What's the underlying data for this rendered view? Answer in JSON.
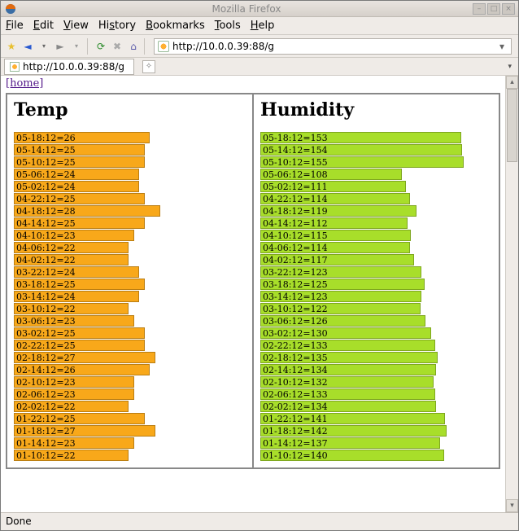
{
  "window": {
    "title": "Mozilla Firefox"
  },
  "menu": {
    "file": "File",
    "edit": "Edit",
    "view": "View",
    "history": "History",
    "bookmarks": "Bookmarks",
    "tools": "Tools",
    "help": "Help"
  },
  "url": "http://10.0.0.39:88/g",
  "tab_label": "http://10.0.0.39:88/g",
  "home_link": "[home]",
  "status": "Done",
  "chart_data": [
    {
      "type": "bar",
      "title": "Temp",
      "orientation": "horizontal",
      "color": "#f8a81a",
      "max": 28,
      "series": [
        {
          "label": "05-18:12",
          "value": 26
        },
        {
          "label": "05-14:12",
          "value": 25
        },
        {
          "label": "05-10:12",
          "value": 25
        },
        {
          "label": "05-06:12",
          "value": 24
        },
        {
          "label": "05-02:12",
          "value": 24
        },
        {
          "label": "04-22:12",
          "value": 25
        },
        {
          "label": "04-18:12",
          "value": 28
        },
        {
          "label": "04-14:12",
          "value": 25
        },
        {
          "label": "04-10:12",
          "value": 23
        },
        {
          "label": "04-06:12",
          "value": 22
        },
        {
          "label": "04-02:12",
          "value": 22
        },
        {
          "label": "03-22:12",
          "value": 24
        },
        {
          "label": "03-18:12",
          "value": 25
        },
        {
          "label": "03-14:12",
          "value": 24
        },
        {
          "label": "03-10:12",
          "value": 22
        },
        {
          "label": "03-06:12",
          "value": 23
        },
        {
          "label": "03-02:12",
          "value": 25
        },
        {
          "label": "02-22:12",
          "value": 25
        },
        {
          "label": "02-18:12",
          "value": 27
        },
        {
          "label": "02-14:12",
          "value": 26
        },
        {
          "label": "02-10:12",
          "value": 23
        },
        {
          "label": "02-06:12",
          "value": 23
        },
        {
          "label": "02-02:12",
          "value": 22
        },
        {
          "label": "01-22:12",
          "value": 25
        },
        {
          "label": "01-18:12",
          "value": 27
        },
        {
          "label": "01-14:12",
          "value": 23
        },
        {
          "label": "01-10:12",
          "value": 22
        }
      ]
    },
    {
      "type": "bar",
      "title": "Humidity",
      "orientation": "horizontal",
      "color": "#a8de2a",
      "max": 155,
      "series": [
        {
          "label": "05-18:12",
          "value": 153
        },
        {
          "label": "05-14:12",
          "value": 154
        },
        {
          "label": "05-10:12",
          "value": 155
        },
        {
          "label": "05-06:12",
          "value": 108
        },
        {
          "label": "05-02:12",
          "value": 111
        },
        {
          "label": "04-22:12",
          "value": 114
        },
        {
          "label": "04-18:12",
          "value": 119
        },
        {
          "label": "04-14:12",
          "value": 112
        },
        {
          "label": "04-10:12",
          "value": 115
        },
        {
          "label": "04-06:12",
          "value": 114
        },
        {
          "label": "04-02:12",
          "value": 117
        },
        {
          "label": "03-22:12",
          "value": 123
        },
        {
          "label": "03-18:12",
          "value": 125
        },
        {
          "label": "03-14:12",
          "value": 123
        },
        {
          "label": "03-10:12",
          "value": 122
        },
        {
          "label": "03-06:12",
          "value": 126
        },
        {
          "label": "03-02:12",
          "value": 130
        },
        {
          "label": "02-22:12",
          "value": 133
        },
        {
          "label": "02-18:12",
          "value": 135
        },
        {
          "label": "02-14:12",
          "value": 134
        },
        {
          "label": "02-10:12",
          "value": 132
        },
        {
          "label": "02-06:12",
          "value": 133
        },
        {
          "label": "02-02:12",
          "value": 134
        },
        {
          "label": "01-22:12",
          "value": 141
        },
        {
          "label": "01-18:12",
          "value": 142
        },
        {
          "label": "01-14:12",
          "value": 137
        },
        {
          "label": "01-10:12",
          "value": 140
        }
      ]
    }
  ]
}
